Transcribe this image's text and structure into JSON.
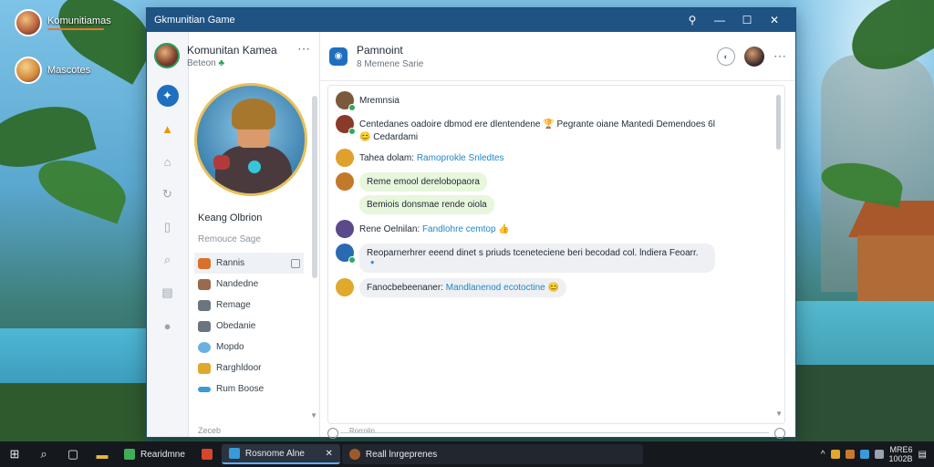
{
  "desktop": {
    "icons": [
      {
        "label": "Komunitiamas",
        "badge": ""
      },
      {
        "label": "Mascotes"
      }
    ]
  },
  "window": {
    "title": "Gkmunitian Game",
    "controls": {
      "search": "⚲",
      "minimize": "—",
      "maximize": "☐",
      "close": "✕"
    }
  },
  "me": {
    "name": "Komunitan Kamea",
    "status": "Beteon"
  },
  "rail": {
    "icons": [
      "compass-icon",
      "warning-icon",
      "home-icon",
      "refresh-icon",
      "bookmark-icon",
      "search-icon",
      "document-icon",
      "user-icon"
    ]
  },
  "profile": {
    "name": "Keang Olbrion",
    "subtitle": "Remouce Sage",
    "menu": [
      {
        "label": "Rannis",
        "color": "#d9712c"
      },
      {
        "label": "Nandedne",
        "color": "#9a6a4a"
      },
      {
        "label": "Remage",
        "color": "#6a7580"
      },
      {
        "label": "Obedanie",
        "color": "#6a7580"
      },
      {
        "label": "Mopdo",
        "color": "#6ab0e0"
      },
      {
        "label": "Rarghldoor",
        "color": "#e0a82c"
      },
      {
        "label": "Rum Boose",
        "color": "#3a9ad8"
      }
    ],
    "footer": "Zeceb"
  },
  "channel": {
    "title": "Pamnoint",
    "subtitle": "8 Memene Sarie"
  },
  "messages": [
    {
      "type": "text",
      "avatar": "#7a5a3a",
      "online": true,
      "text": "Mremnsia",
      "link": ""
    },
    {
      "type": "text",
      "avatar": "#8a3a2a",
      "online": true,
      "text": "Centedanes oadoire dbmod ere dlentendene 🏆 Pegrante oiane Mantedi Demendoes 6l 😊 Cedardami",
      "link": ""
    },
    {
      "type": "text",
      "avatar": "#e0a02c",
      "online": false,
      "text": "Tahea dolam:",
      "link": "Ramoprokle Snledtes"
    },
    {
      "type": "bubbles",
      "avatar": "#c2792a",
      "online": false,
      "bubbles": [
        "Reme emool derelobopaora",
        "Bemiois donsmae rende oiola"
      ]
    },
    {
      "type": "text",
      "avatar": "#5a4a8a",
      "online": false,
      "text": "Rene Oelnilan:",
      "link": "Fandlohre cemtop 👍"
    },
    {
      "type": "gray",
      "avatar": "#2a6ab0",
      "online": true,
      "text": "Reoparnerhrer eeend dinet s priuds tceneteciene beri becodad col. lndiera Feoarr. 🔹"
    },
    {
      "type": "gray-link",
      "avatar": "#e0a82c",
      "online": false,
      "text": "Fanocbebeenaner:",
      "link": "Mandlanenod ecotoctine 😊"
    }
  ],
  "composer": {
    "placeholder": "Rorrolin"
  },
  "taskbar": {
    "tasks": [
      {
        "label": "Rearidmne",
        "color": "#3fae5a",
        "active": false
      },
      {
        "label": "",
        "color": "#d8452c",
        "active": false
      },
      {
        "label": "Rosnome Alne",
        "color": "#3a9ad8",
        "active": true
      },
      {
        "label": "Reall lnrgeprenes",
        "color": "#a05a2a",
        "active": false
      }
    ],
    "clock_time": "MRE6",
    "clock_date": "1002B"
  }
}
